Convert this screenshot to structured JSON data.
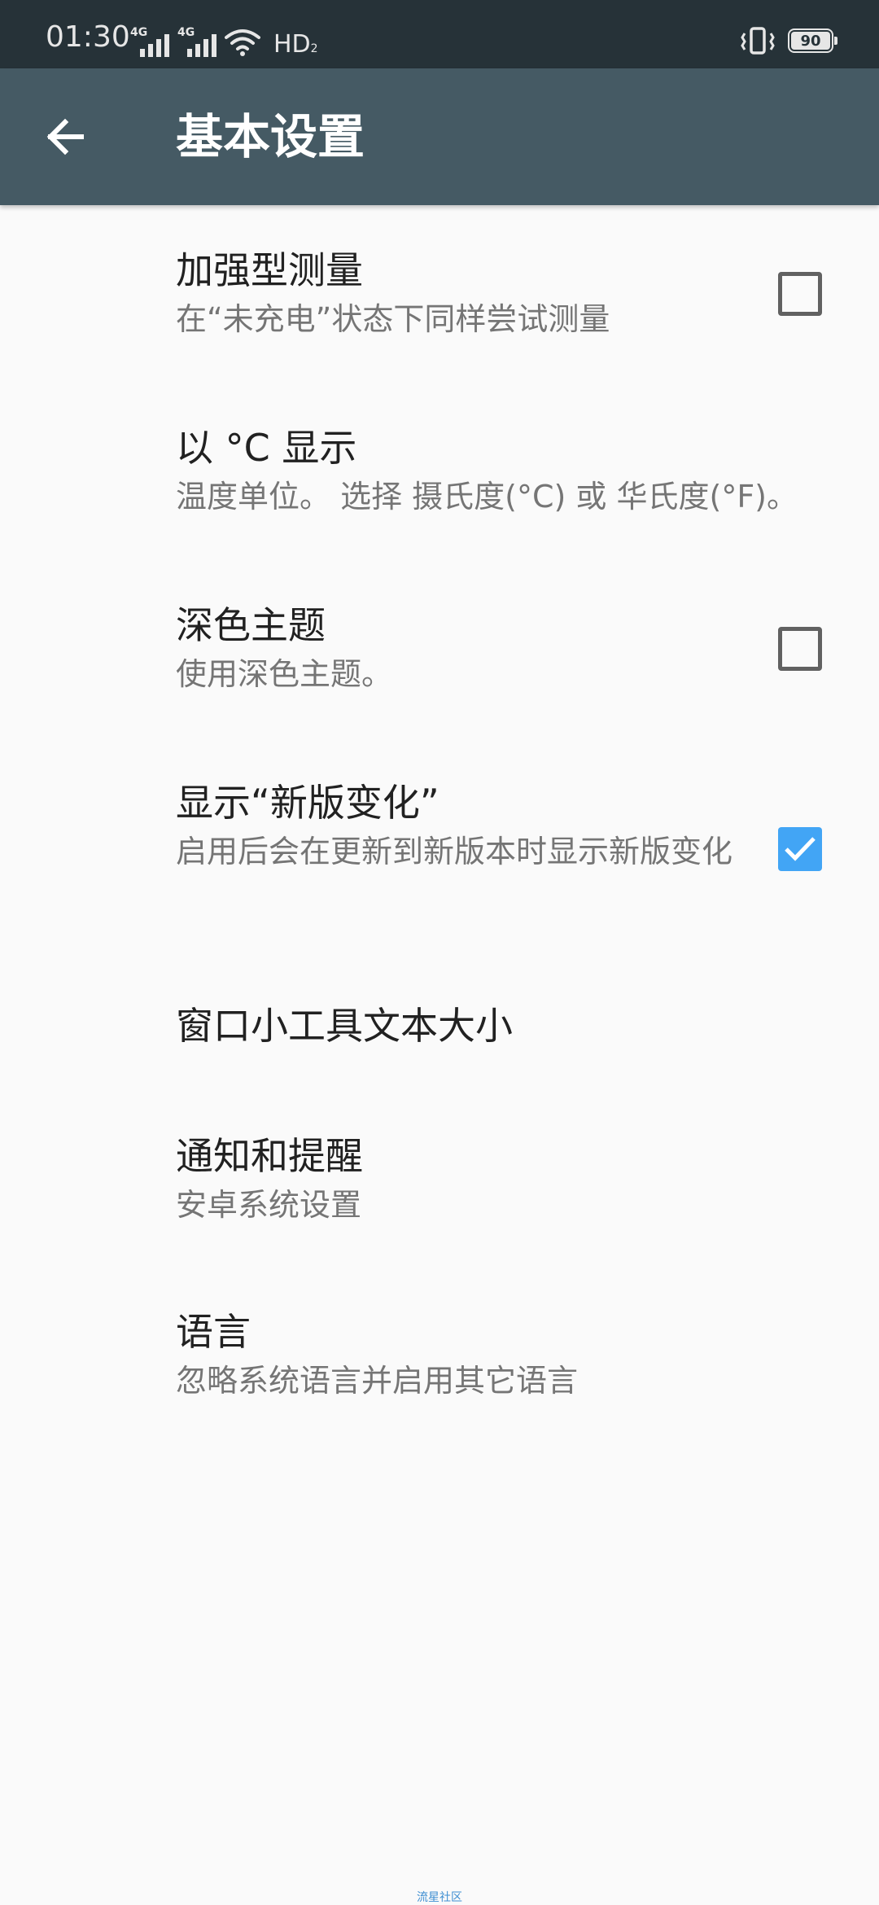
{
  "status_bar": {
    "time": "01:30",
    "network_1": "4G",
    "network_2": "4G",
    "hd_label": "HD",
    "hd_sub": "2",
    "battery_level": "90",
    "icons": [
      "signal-icon",
      "signal-icon",
      "wifi-icon",
      "vibrate-icon",
      "battery-icon"
    ]
  },
  "app_bar": {
    "back_icon": "arrow-back-icon",
    "title": "基本设置"
  },
  "preferences": [
    {
      "title": "加强型测量",
      "summary": "在“未充电”状态下同样尝试测量",
      "checkbox": true,
      "checked": false
    },
    {
      "title": "以 °C 显示",
      "summary": "温度单位。 选择 摄氏度(°C) 或 华氏度(°F)。",
      "checkbox": false
    },
    {
      "title": "深色主题",
      "summary": "使用深色主题。",
      "checkbox": true,
      "checked": false
    },
    {
      "title": "显示“新版变化”",
      "summary": "启用后会在更新到新版本时显示新版变化",
      "checkbox": true,
      "checked": true
    },
    {
      "title": "窗口小工具文本大小",
      "summary": "",
      "checkbox": false
    },
    {
      "title": "通知和提醒",
      "summary": "安卓系统设置",
      "checkbox": false
    },
    {
      "title": "语言",
      "summary": "忽略系统语言并启用其它语言",
      "checkbox": false
    }
  ],
  "watermark": "流星社区",
  "colors": {
    "status_bar": "#263238",
    "app_bar": "#455a64",
    "background": "#fafafa",
    "checkbox_checked": "#42a5f5",
    "title_text": "#212121",
    "summary_text": "#757575"
  }
}
